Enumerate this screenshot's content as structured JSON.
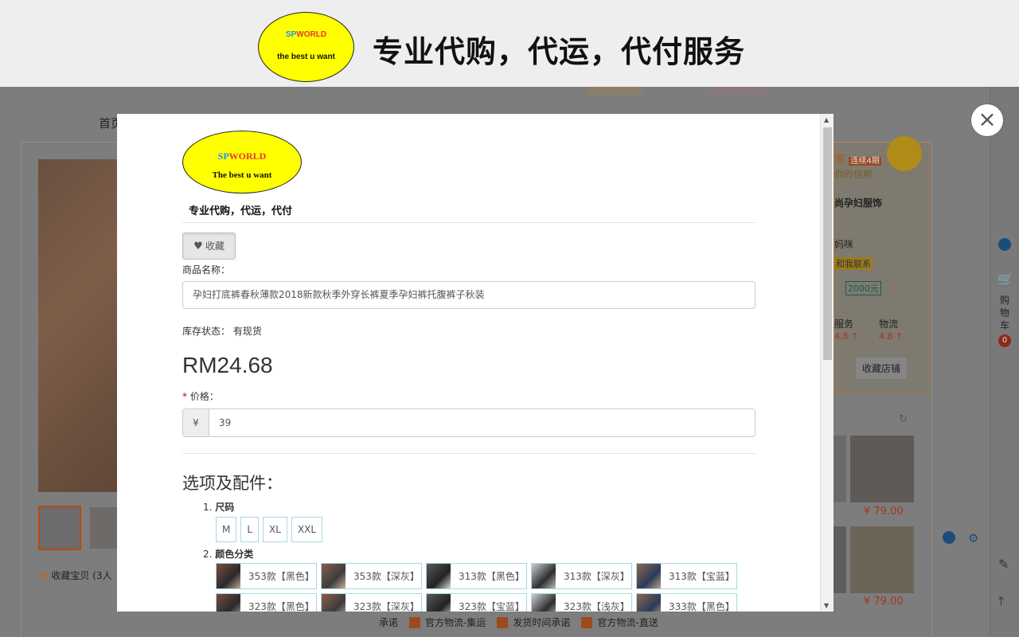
{
  "banner": {
    "logo_line1_a": "SP",
    "logo_line1_b": "WORLD",
    "logo_line2": "the best u want",
    "title": "专业代购，代运，代付服务"
  },
  "background": {
    "nav_first": "首页",
    "favorite_text": "收藏宝贝 (3人",
    "shop": {
      "tag": "家",
      "badge": "连续4期",
      "trust": "你的信赖",
      "name": "尚孕妇服饰",
      "person": "妈咪",
      "contact": "和我联系",
      "deposit": "2000元",
      "service_label": "服务",
      "logistics_label": "物流",
      "service_score": "4.8 ↑",
      "logistics_score": "4.8 ↑",
      "follow_button": "收藏店铺"
    },
    "prices": [
      "¥ 79.00",
      "¥ 79.00"
    ],
    "footer": [
      "承诺",
      "官方物流-集运",
      "发货时间承诺",
      "官方物流-直送"
    ],
    "cart_label": "购物车",
    "cart_count": "0"
  },
  "modal": {
    "logo_line1_a": "SP",
    "logo_line1_b": "WORLD",
    "logo_line2": "The best u want",
    "tagline": "专业代购，代运，代付",
    "favorite_button": "收藏",
    "name_label": "商品名称：",
    "name_value": "孕妇打底裤春秋薄款2018新款秋季外穿长裤夏季孕妇裤托腹裤子秋装",
    "stock_label": "库存状态：",
    "stock_value": "有现货",
    "price_display": "RM24.68",
    "price_label": "价格：",
    "price_required_mark": "*",
    "currency_symbol": "¥",
    "price_value": "39",
    "options_title": "选项及配件：",
    "size_section": "尺码",
    "size_index": "1.",
    "sizes": [
      "M",
      "L",
      "XL",
      "XXL"
    ],
    "color_section": "颜色分类",
    "color_index": "2.",
    "colors": [
      "353款【黑色】",
      "353款【深灰】",
      "313款【黑色】",
      "313款【深灰】",
      "313款【宝蓝】",
      "323款【黑色】",
      "323款【深灰】",
      "323款【宝蓝】",
      "323款【浅灰】",
      "333款【黑色】"
    ]
  },
  "icons": {
    "close": "close-icon",
    "heart": "heart-icon",
    "cart": "cart-icon",
    "edit": "pencil-icon",
    "top": "back-to-top-icon"
  }
}
